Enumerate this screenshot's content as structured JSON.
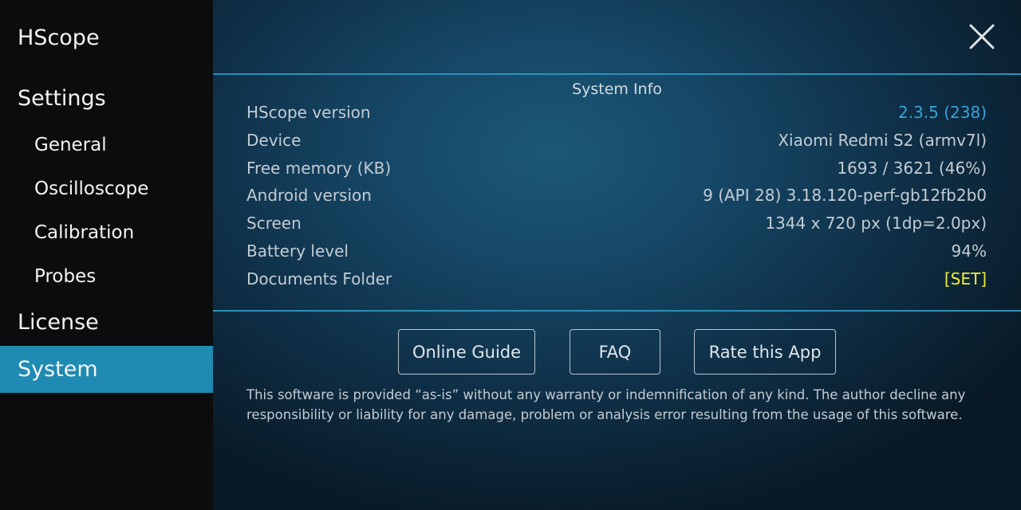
{
  "sidebar": {
    "app_title": "HScope",
    "settings_label": "Settings",
    "items": [
      {
        "label": "General"
      },
      {
        "label": "Oscilloscope"
      },
      {
        "label": "Calibration"
      },
      {
        "label": "Probes"
      }
    ],
    "license_label": "License",
    "system_label": "System",
    "active_color": "#1f8ab2"
  },
  "header": {
    "close_icon": "close-icon"
  },
  "system_info": {
    "title": "System Info",
    "rows": [
      {
        "label": "HScope version",
        "value": "2.3.5 (238)"
      },
      {
        "label": "Device",
        "value": "Xiaomi Redmi S2 (armv7l)"
      },
      {
        "label": "Free memory (KB)",
        "value": "1693 / 3621 (46%)"
      },
      {
        "label": "Android version",
        "value": "9 (API 28) 3.18.120-perf-gb12fb2b0"
      },
      {
        "label": "Screen",
        "value": "1344 x 720 px (1dp=2.0px)"
      },
      {
        "label": "Battery level",
        "value": "94%"
      },
      {
        "label": "Documents Folder",
        "value": "[SET]"
      }
    ],
    "version_color": "#3aa2d8",
    "set_color": "#eaf03c"
  },
  "buttons": {
    "online_guide": "Online Guide",
    "faq": "FAQ",
    "rate_app": "Rate this App"
  },
  "disclaimer": "This software is provided “as-is” without any warranty or indemnification of any kind. The author decline any responsibility or liability for any damage, problem or analysis error resulting from the usage of this software."
}
